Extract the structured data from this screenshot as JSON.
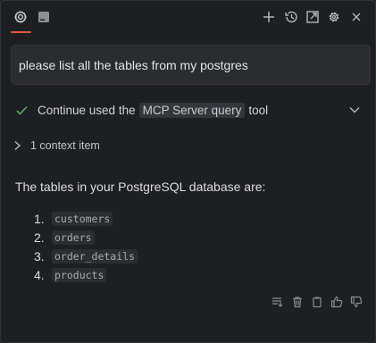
{
  "topbar": {
    "tabs": [
      {
        "icon": "continue-logo-icon",
        "active": true
      },
      {
        "icon": "terminal-icon",
        "active": false
      }
    ],
    "toolbar_icons": [
      "plus-icon",
      "history-icon",
      "open-external-icon",
      "gear-icon",
      "close-icon"
    ]
  },
  "prompt": {
    "text": "please list all the tables from my postgres"
  },
  "tool_call": {
    "prefix": "Continue used the",
    "tool_name": "MCP Server query",
    "suffix": "tool",
    "status_color": "#4caf68"
  },
  "context": {
    "label": "1 context item"
  },
  "answer": {
    "intro": "The tables in your PostgreSQL database are:",
    "items": [
      {
        "num": "1.",
        "name": "customers"
      },
      {
        "num": "2.",
        "name": "orders"
      },
      {
        "num": "3.",
        "name": "order_details"
      },
      {
        "num": "4.",
        "name": "products"
      }
    ]
  },
  "actions": [
    "insert-icon",
    "trash-icon",
    "copy-icon",
    "thumbs-up-icon",
    "thumbs-down-icon"
  ],
  "colors": {
    "background": "#1e1f22",
    "accent": "#e0563b"
  }
}
